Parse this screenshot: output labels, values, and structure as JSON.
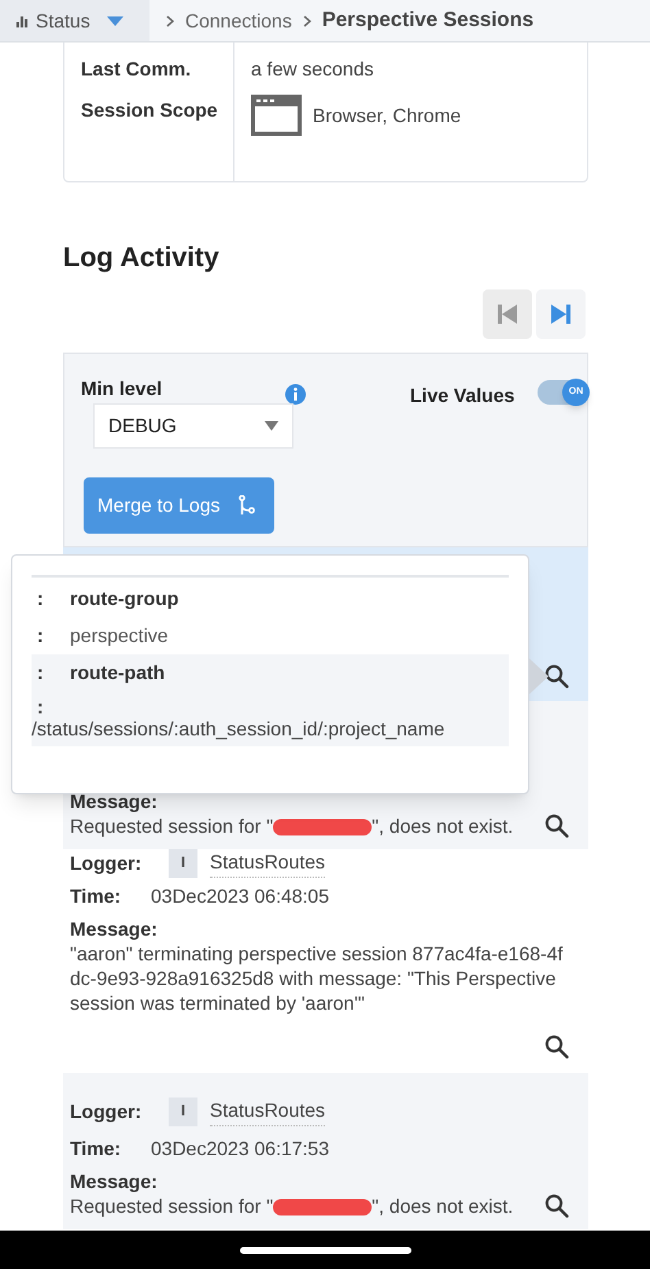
{
  "breadcrumb": {
    "menu": "Status",
    "items": [
      {
        "label": "Connections",
        "current": false
      },
      {
        "label": "Perspective Sessions",
        "current": true
      }
    ]
  },
  "details": [
    {
      "label": "Last Comm.",
      "value": "a few seconds"
    },
    {
      "label": "Session Scope",
      "value": "Browser, Chrome",
      "kind": "browser"
    }
  ],
  "log_activity": {
    "title": "Log Activity",
    "nav": [
      {
        "kind": "first",
        "disabled": true
      },
      {
        "kind": "last",
        "disabled": false
      }
    ],
    "min_level": {
      "label": "Min level",
      "value": "DEBUG"
    },
    "live_values": {
      "label": "Live Values",
      "on": true,
      "state_text": "ON"
    },
    "merge_button": "Merge to Logs",
    "entries": [
      {
        "selected": true
      },
      {
        "selected": false,
        "message_label": "Message:",
        "message_before": "Requested session for \"",
        "redacted": true,
        "message_after": "\", does not exist."
      },
      {
        "selected": false,
        "logger_label": "Logger:",
        "level": "I",
        "logger": "StatusRoutes",
        "time_label": "Time:",
        "time": "03Dec2023 06:48:05",
        "message_label": "Message:",
        "message_before": "\"aaron\" terminating perspective session 877ac4fa-e168-4fdc-9e93-928a916325d8 with message: \"This Perspective session was terminated by 'aaron'\"",
        "redacted": false
      },
      {
        "selected": false,
        "logger_label": "Logger:",
        "level": "I",
        "logger": "StatusRoutes",
        "time_label": "Time:",
        "time": "03Dec2023 06:17:53",
        "message_label": "Message:",
        "message_before": "Requested session for \"",
        "redacted": true,
        "message_after": "\", does not exist."
      }
    ]
  },
  "popover": {
    "rows": [
      {
        "key_sep": ":",
        "key": "route-group",
        "value_sep": ":",
        "value": "perspective",
        "selected": false
      },
      {
        "key_sep": ":",
        "key": "route-path",
        "value_sep": ":",
        "value": "/status/sessions/:auth_session_id/:project_name",
        "selected": true
      }
    ]
  }
}
